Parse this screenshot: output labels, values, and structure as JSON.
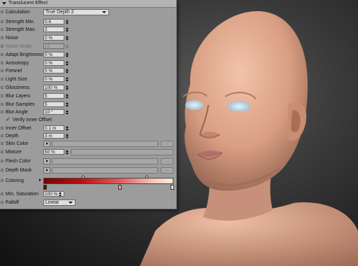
{
  "panel": {
    "title": "Translucent Effect"
  },
  "rows": {
    "calculation": {
      "label": "Calculation",
      "value": "True Depth 2"
    },
    "strength_min": {
      "label": "Strength Min.",
      "value": "0.6"
    },
    "strength_max": {
      "label": "Strength Max.",
      "value": "2"
    },
    "noise": {
      "label": "Noise",
      "value": "0 %"
    },
    "noise_scale": {
      "label": "Noise Scale",
      "value": "10"
    },
    "adapt_brightness": {
      "label": "Adapt Brightness",
      "value": "0 %"
    },
    "anisotropy": {
      "label": "Anisotropy",
      "value": "0 %"
    },
    "fresnel": {
      "label": "Fresnel",
      "value": "0 %"
    },
    "light_size": {
      "label": "Light Size",
      "value": "0 %"
    },
    "glossiness": {
      "label": "Glossiness",
      "value": "100 %"
    },
    "blur_layers": {
      "label": "Blur Layers",
      "value": "5"
    },
    "blur_samples": {
      "label": "Blur Samples",
      "value": "5"
    },
    "blur_angle": {
      "label": "Blur Angle",
      "value": "10 °"
    },
    "verify_inner_offset": {
      "label": "Verify Inner Offset",
      "checkmark": "✓"
    },
    "inner_offset": {
      "label": "Inner Offset",
      "value": "0.1 m"
    },
    "depth": {
      "label": "Depth",
      "value": "3 m"
    },
    "skin_color": {
      "label": "Skin Color",
      "dots": "..."
    },
    "mixture": {
      "label": "Mixture",
      "value": "50 %"
    },
    "flesh_color": {
      "label": "Flesh Color",
      "dots": "..."
    },
    "depth_mask": {
      "label": "Depth Mask",
      "dots": "..."
    },
    "coloring": {
      "label": "Coloring"
    },
    "min_saturation": {
      "label": "Min. Saturation",
      "value": "100 %"
    },
    "falloff": {
      "label": "Falloff",
      "value": "Linear"
    }
  },
  "colors": {
    "gradient_start": "#7a0000",
    "gradient_end": "#fbe6dc",
    "panel_bg": "#9c9c9c"
  }
}
